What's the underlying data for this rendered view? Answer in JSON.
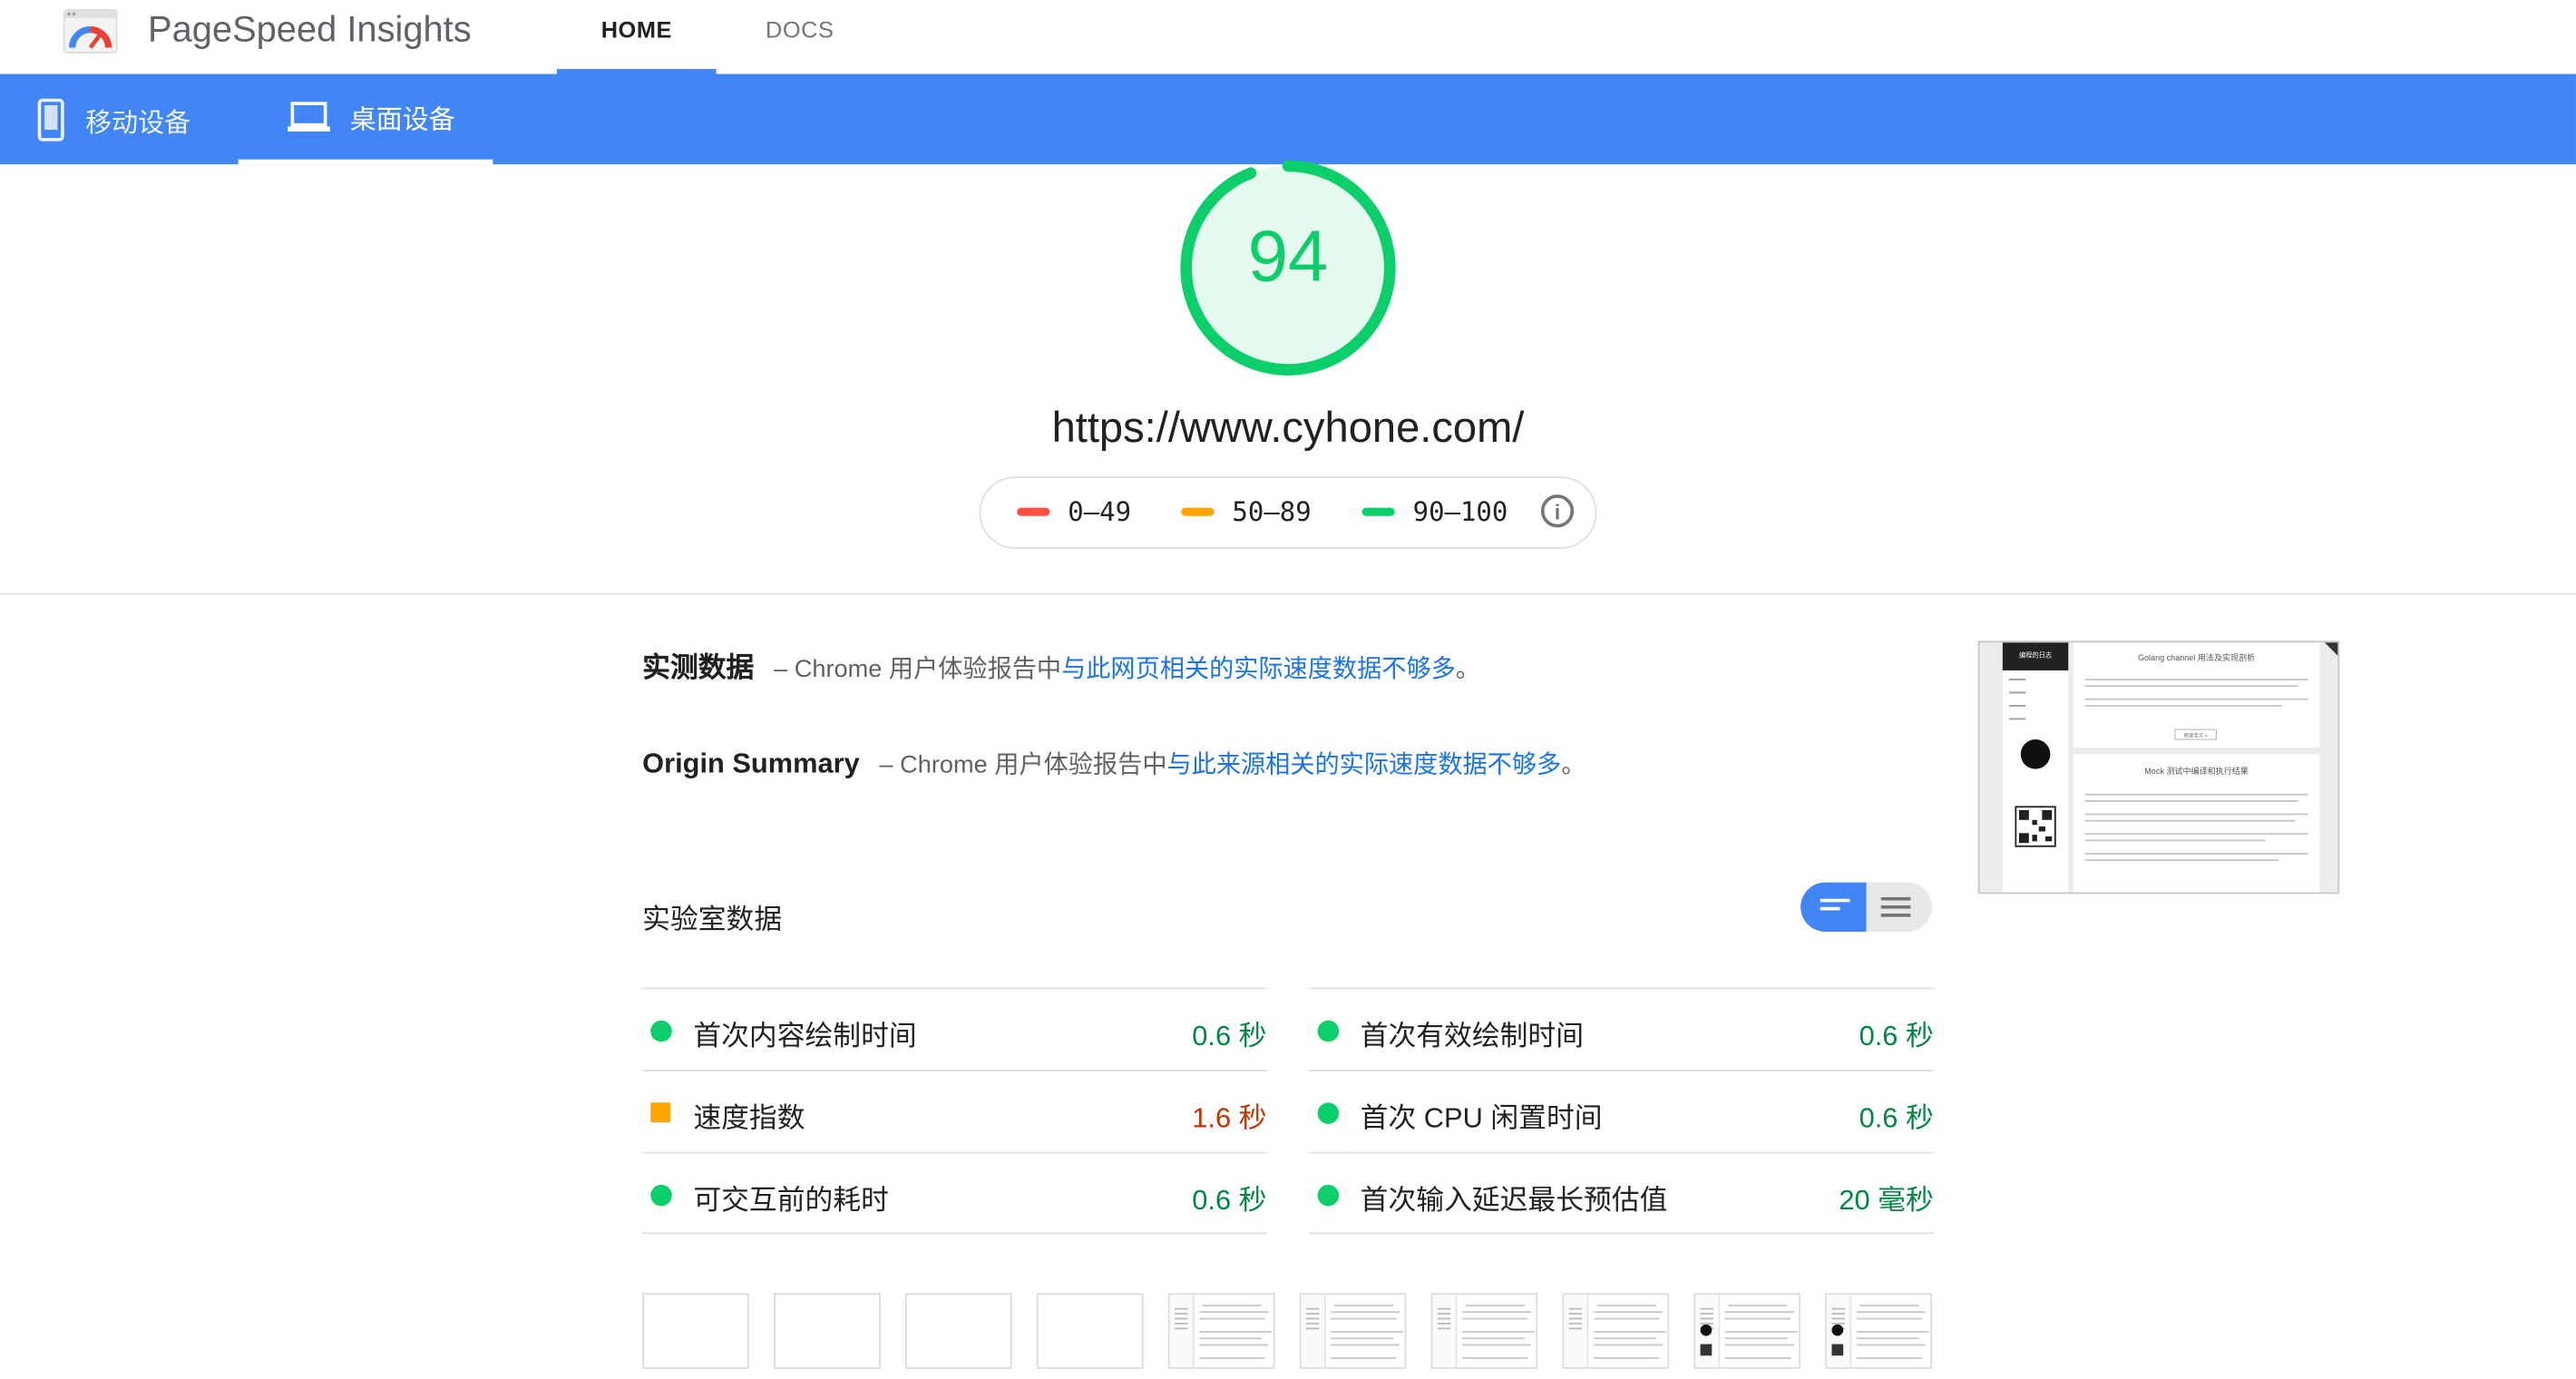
{
  "app": {
    "name": "PageSpeed Insights"
  },
  "nav": {
    "home": "HOME",
    "docs": "DOCS"
  },
  "devices": {
    "mobile": "移动设备",
    "desktop": "桌面设备",
    "selected": "desktop"
  },
  "score": {
    "value": "94",
    "fraction": 0.94,
    "color": "#0cce6b"
  },
  "url": "https://www.cyhone.com/",
  "legend": [
    {
      "range": "0–49",
      "color": "#ff4e42"
    },
    {
      "range": "50–89",
      "color": "#ffa400"
    },
    {
      "range": "90–100",
      "color": "#0cce6b"
    }
  ],
  "field": {
    "title": "实测数据",
    "prefix": "– Chrome 用户体验报告中",
    "link": "与此网页相关的实际速度数据不够多",
    "suffix": "。"
  },
  "origin": {
    "title": "Origin Summary",
    "prefix": "– Chrome 用户体验报告中",
    "link": "与此来源相关的实际速度数据不够多",
    "suffix": "。"
  },
  "lab": {
    "title": "实验室数据"
  },
  "metrics": [
    {
      "label": "首次内容绘制时间",
      "value": "0.6 秒",
      "rating": "pass"
    },
    {
      "label": "首次有效绘制时间",
      "value": "0.6 秒",
      "rating": "pass"
    },
    {
      "label": "速度指数",
      "value": "1.6 秒",
      "rating": "average"
    },
    {
      "label": "首次 CPU 闲置时间",
      "value": "0.6 秒",
      "rating": "pass"
    },
    {
      "label": "可交互前的耗时",
      "value": "0.6 秒",
      "rating": "pass"
    },
    {
      "label": "首次输入延迟最长预估值",
      "value": "20 毫秒",
      "rating": "pass"
    }
  ],
  "preview": {
    "site_title": "编程的日志",
    "post1_title": "Golang channel 用法及实现剖析",
    "post2_title": "Mock 测试中编译和执行结果",
    "read_more": "阅读全文 »"
  },
  "filmstrip": {
    "frames": 10,
    "blank_frames": 4
  }
}
